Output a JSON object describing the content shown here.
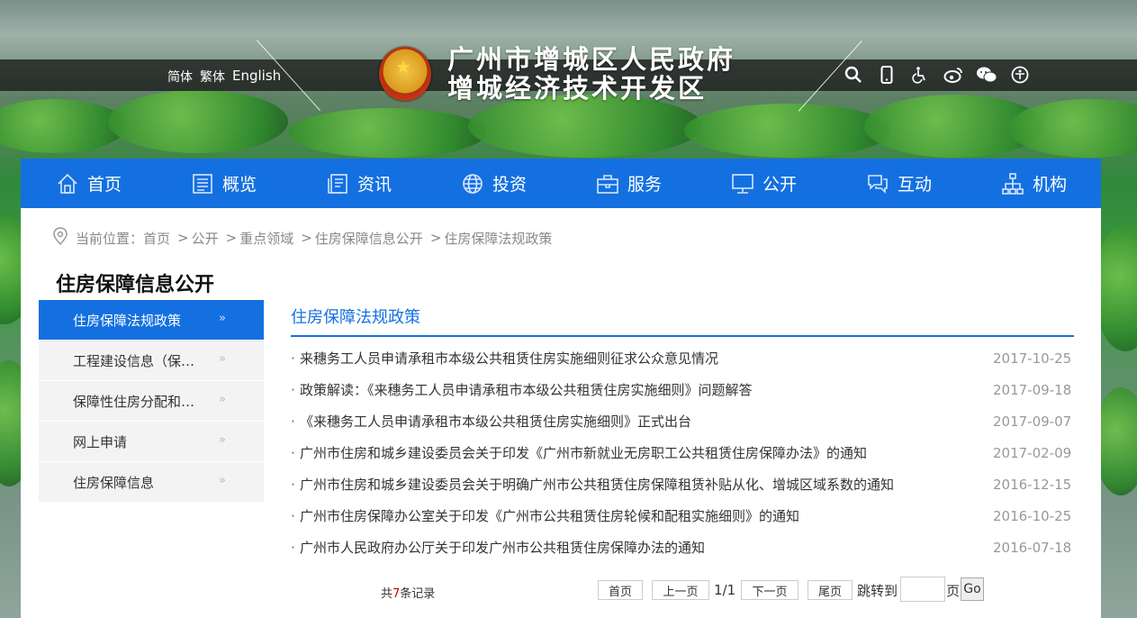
{
  "header": {
    "lang_simplified": "简体",
    "lang_traditional": "繁体",
    "lang_english": "English",
    "title_line1": "广州市增城区人民政府",
    "title_line2": "增城经济技术开发区",
    "tool_icons": [
      "search-icon",
      "mobile-icon",
      "accessibility-icon",
      "weibo-icon",
      "wechat-icon",
      "accessible-reading-icon"
    ]
  },
  "nav": {
    "items": [
      {
        "label": "首页",
        "icon": "home-icon"
      },
      {
        "label": "概览",
        "icon": "overview-icon"
      },
      {
        "label": "资讯",
        "icon": "news-icon"
      },
      {
        "label": "投资",
        "icon": "globe-icon"
      },
      {
        "label": "服务",
        "icon": "briefcase-icon"
      },
      {
        "label": "公开",
        "icon": "monitor-icon"
      },
      {
        "label": "互动",
        "icon": "chat-icon"
      },
      {
        "label": "机构",
        "icon": "org-chart-icon"
      }
    ]
  },
  "breadcrumb": {
    "prefix": "当前位置：",
    "items": [
      "首页",
      "公开",
      "重点领域",
      "住房保障信息公开",
      "住房保障法规政策"
    ]
  },
  "sidebar": {
    "title": "住房保障信息公开",
    "items": [
      {
        "label": "住房保障法规政策",
        "active": true
      },
      {
        "label": "工程建设信息（保障性住房）"
      },
      {
        "label": "保障性住房分配和退出信息"
      },
      {
        "label": "网上申请"
      },
      {
        "label": "住房保障信息"
      }
    ]
  },
  "main": {
    "section_title": "住房保障法规政策",
    "articles": [
      {
        "title": "来穗务工人员申请承租市本级公共租赁住房实施细则征求公众意见情况",
        "date": "2017-10-25"
      },
      {
        "title": "政策解读：《来穗务工人员申请承租市本级公共租赁住房实施细则》问题解答",
        "date": "2017-09-18"
      },
      {
        "title": "《来穗务工人员申请承租市本级公共租赁住房实施细则》正式出台",
        "date": "2017-09-07"
      },
      {
        "title": "广州市住房和城乡建设委员会关于印发《广州市新就业无房职工公共租赁住房保障办法》的通知",
        "date": "2017-02-09"
      },
      {
        "title": "广州市住房和城乡建设委员会关于明确广州市公共租赁住房保障租赁补贴从化、增城区域系数的通知",
        "date": "2016-12-15"
      },
      {
        "title": "广州市住房保障办公室关于印发《广州市公共租赁住房轮候和配租实施细则》的通知",
        "date": "2016-10-25"
      },
      {
        "title": "广州市人民政府办公厅关于印发广州市公共租赁住房保障办法的通知",
        "date": "2016-07-18"
      }
    ]
  },
  "pager": {
    "total_prefix": "共",
    "total_count": "7",
    "total_suffix": "条记录",
    "first": "首页",
    "prev": "上一页",
    "page_info": "1/1",
    "next": "下一页",
    "last": "尾页",
    "jump_label": "跳转到",
    "page_unit": "页",
    "go": "Go"
  },
  "colors": {
    "brand_blue": "#1470e0",
    "date_gray": "#999999",
    "count_red": "#cc0000"
  }
}
